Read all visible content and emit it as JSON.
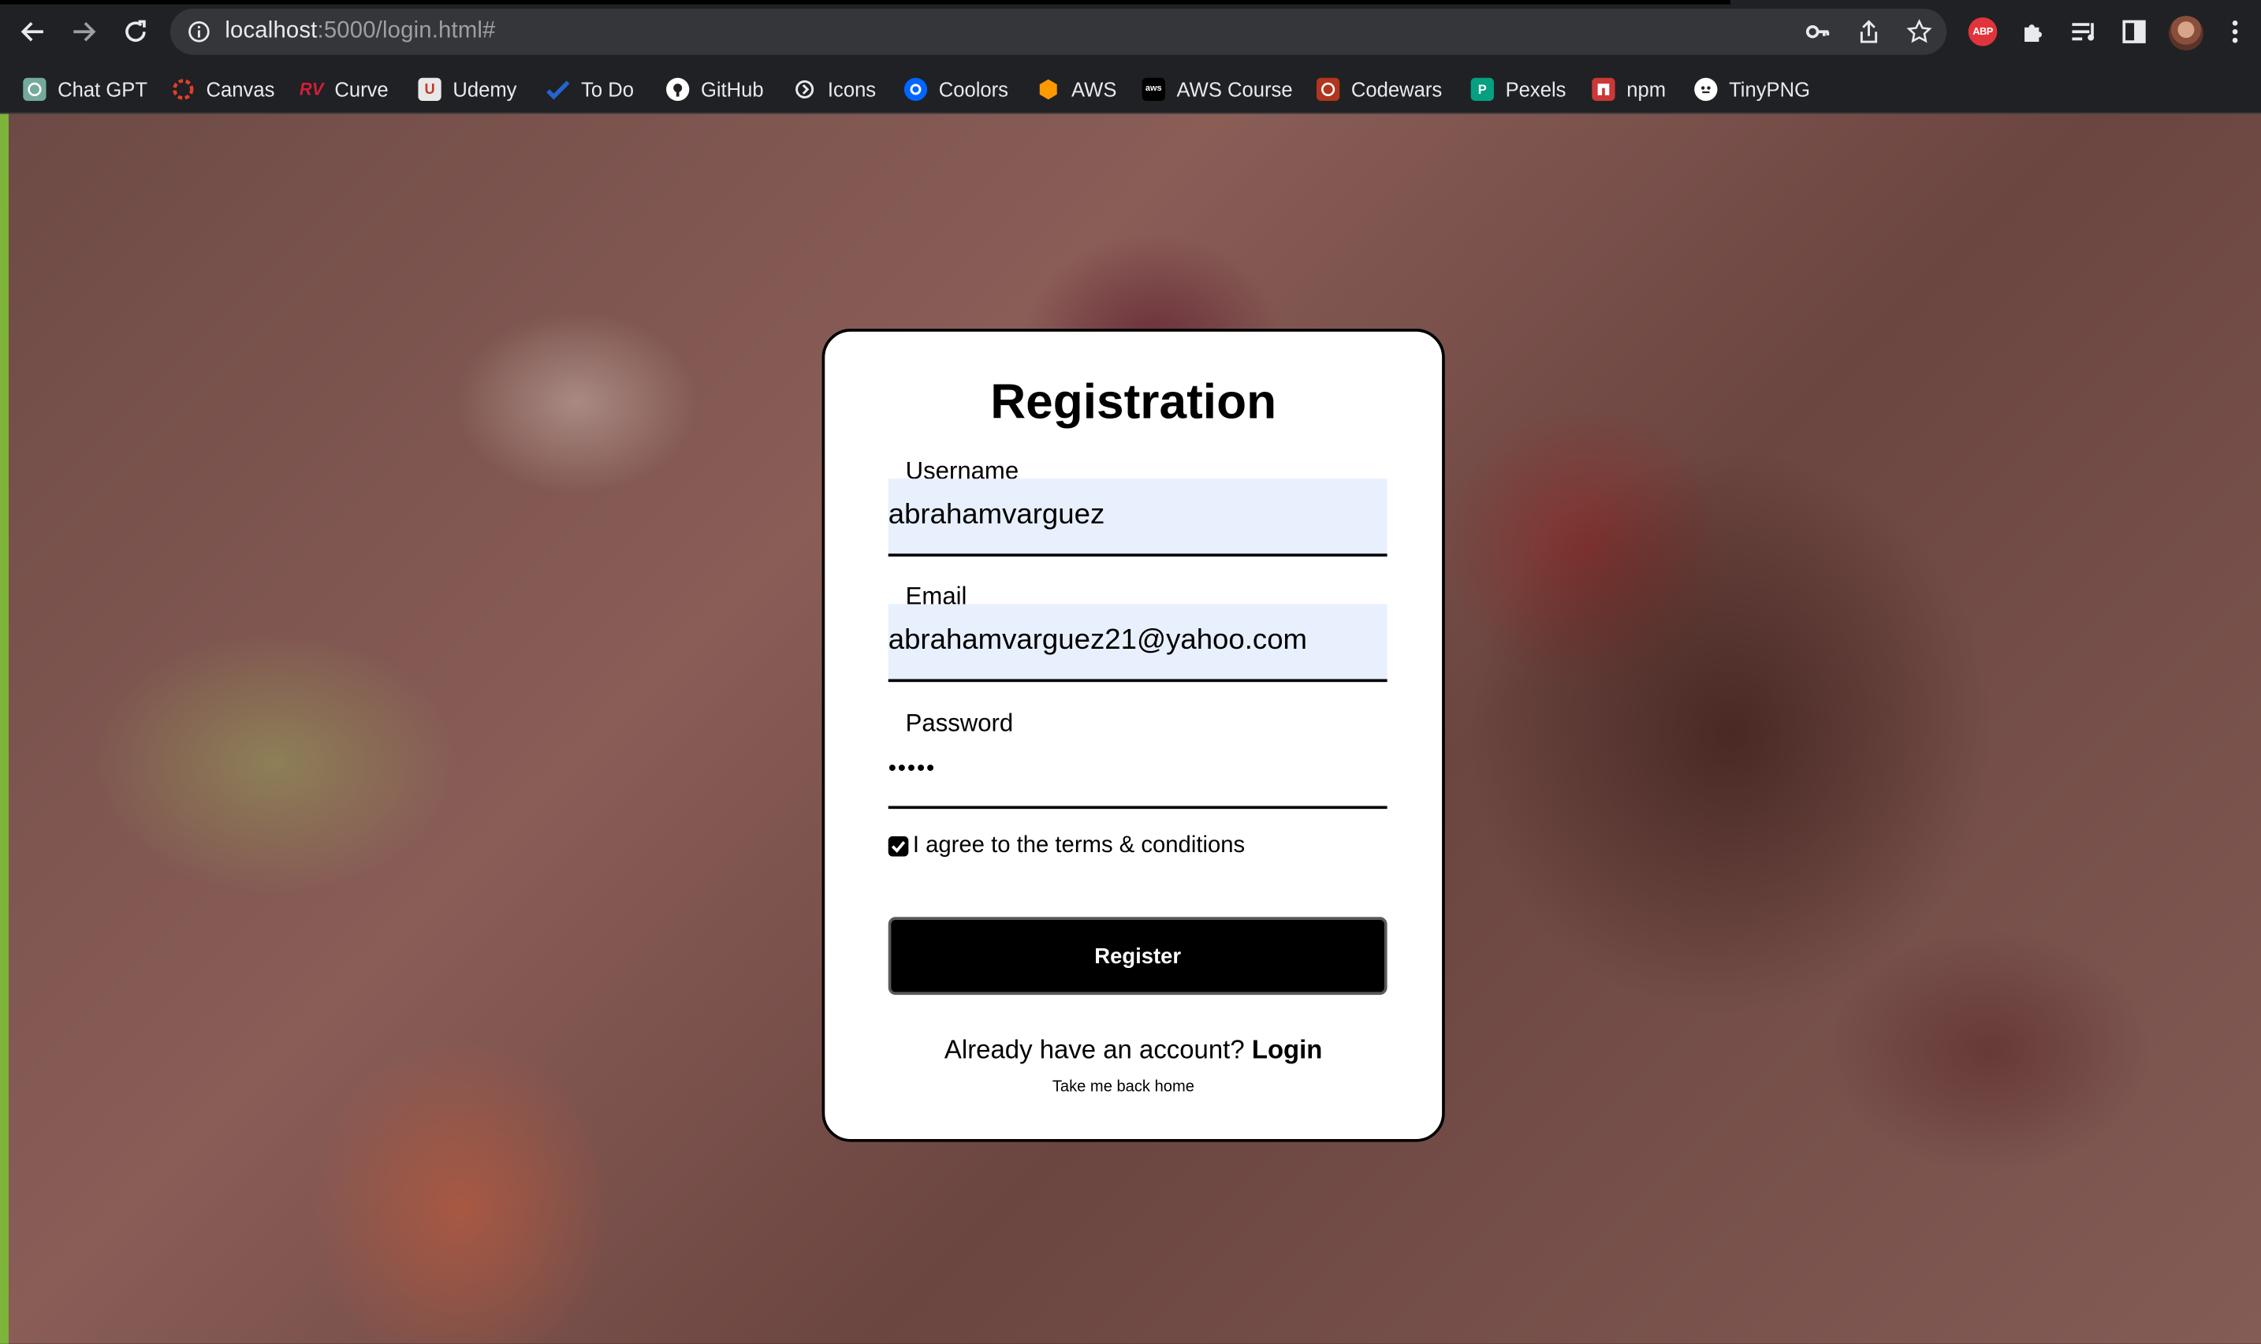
{
  "browser": {
    "url_host": "localhost",
    "url_path": ":5000/login.html#"
  },
  "bookmarks": [
    {
      "label": "Chat GPT",
      "icon": "chatgpt-icon",
      "color": "#74aa9c"
    },
    {
      "label": "Canvas",
      "icon": "canvas-icon",
      "color": "#e13f2b"
    },
    {
      "label": "Curve",
      "icon": "curve-icon",
      "color": "#d11f3a"
    },
    {
      "label": "Udemy",
      "icon": "udemy-icon",
      "color": "#e0e0e0"
    },
    {
      "label": "To Do",
      "icon": "todo-icon",
      "color": "#2564cf"
    },
    {
      "label": "GitHub",
      "icon": "github-icon",
      "color": "#ffffff"
    },
    {
      "label": "Icons",
      "icon": "icons-icon",
      "color": "#ffffff"
    },
    {
      "label": "Coolors",
      "icon": "coolors-icon",
      "color": "#0066ff"
    },
    {
      "label": "AWS",
      "icon": "aws-icon",
      "color": "#ff9900"
    },
    {
      "label": "AWS Course",
      "icon": "aws-course-icon",
      "color": "#232f3e"
    },
    {
      "label": "Codewars",
      "icon": "codewars-icon",
      "color": "#b1361e"
    },
    {
      "label": "Pexels",
      "icon": "pexels-icon",
      "color": "#05a081"
    },
    {
      "label": "npm",
      "icon": "npm-icon",
      "color": "#cb3837"
    },
    {
      "label": "TinyPNG",
      "icon": "tinypng-icon",
      "color": "#ffffff"
    }
  ],
  "extensions": {
    "abp_label": "ABP"
  },
  "form": {
    "title": "Registration",
    "username_label": "Username",
    "username_value": "abrahamvarguez",
    "email_label": "Email",
    "email_value": "abrahamvarguez21@yahoo.com",
    "password_label": "Password",
    "password_value": "•••••",
    "agree_label": "I agree to the terms & conditions",
    "agree_checked": true,
    "register_label": "Register",
    "already_text": "Already have an account?",
    "login_label": "Login",
    "home_link": "Take me back home"
  },
  "colors": {
    "autofill_bg": "#e8f0fe",
    "chrome_bg": "#202124",
    "accent_edge": "#7fb43a"
  }
}
